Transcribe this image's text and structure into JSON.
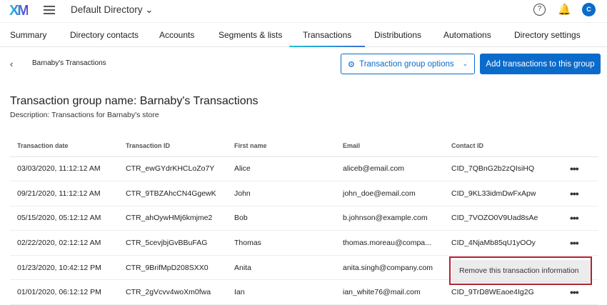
{
  "header": {
    "logo": "XM",
    "directory": "Default Directory ⌄",
    "help": "?",
    "bell": "🔔",
    "avatar": "C"
  },
  "tabs": [
    "Summary",
    "Directory contacts",
    "Accounts",
    "Segments & lists",
    "Transactions",
    "Distributions",
    "Automations",
    "Directory settings"
  ],
  "active_tab": "Transactions",
  "breadcrumb": {
    "back": "‹",
    "label": "Barnaby's Transactions"
  },
  "buttons": {
    "options": "Transaction group options",
    "options_icon": "⚙",
    "options_chevron": "⌄",
    "add": "Add transactions to this group"
  },
  "group": {
    "title": "Transaction group name: Barnaby's Transactions",
    "description": "Description: Transactions for Barnaby's store"
  },
  "table": {
    "headers": [
      "Transaction date",
      "Transaction ID",
      "First name",
      "Email",
      "Contact ID"
    ],
    "rows": [
      [
        "03/03/2020, 11:12:12 AM",
        "CTR_ewGYdrKHCLoZo7Y",
        "Alice",
        "aliceb@email.com",
        "CID_7QBnG2b2zQIsiHQ"
      ],
      [
        "09/21/2020, 11:12:12 AM",
        "CTR_9TBZAhcCN4GgewK",
        "John",
        "john_doe@email.com",
        "CID_9KL33idmDwFxApw"
      ],
      [
        "05/15/2020, 05:12:12 AM",
        "CTR_ahOywHMj6kmjme2",
        "Bob",
        "b.johnson@example.com",
        "CID_7VOZO0V9Uad8sAe"
      ],
      [
        "02/22/2020, 02:12:12 AM",
        "CTR_5cevjbjGvBBuFAG",
        "Thomas",
        "thomas.moreau@compa...",
        "CID_4NjaMb85qU1yOOy"
      ],
      [
        "01/23/2020, 10:42:12 PM",
        "CTR_9BrifMpD208SXX0",
        "Anita",
        "anita.singh@company.com",
        ""
      ],
      [
        "01/01/2020, 06:12:12 PM",
        "CTR_2gVcvv4woXm0fwa",
        "Ian",
        "ian_white76@mail.com",
        "CID_9TrD8WEaoe4Ig2G"
      ]
    ],
    "more": "•••"
  },
  "context_menu": {
    "item": "Remove this transaction information"
  }
}
